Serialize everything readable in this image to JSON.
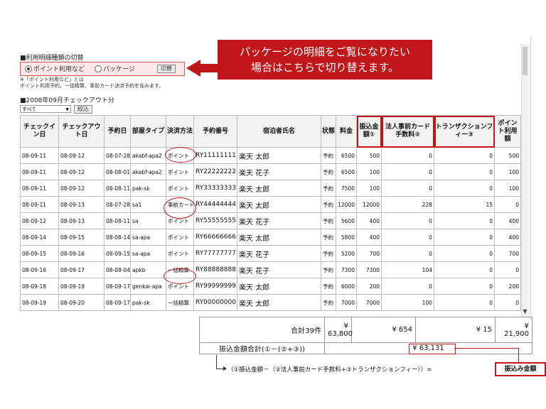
{
  "switch_section": {
    "title": "■利用明細種類の切替",
    "option_point": "ポイント利用など",
    "option_package": "パッケージ",
    "switch_button": "切替",
    "note1": "※「ポイント利用など」とは",
    "note2": "ポイント利用予約、一括精算、事前カード決済予約を含みます。"
  },
  "callout": {
    "line1": "パッケージの明細をご覧になりたい",
    "line2": "場合はこちらで切り替えます。"
  },
  "month_section": {
    "title": "■2008年09月チェックアウト分",
    "filter_value": "すべて",
    "filter_button": "絞込"
  },
  "table": {
    "headers": [
      "チェックイン日",
      "チェックアウト日",
      "予約日",
      "部屋タイプ",
      "決済方法",
      "予約番号",
      "宿泊者氏名",
      "状態",
      "料金",
      "振込金額①",
      "法人事前カード手数料②",
      "トランザクションフィー③",
      "ポイント利用額"
    ],
    "rows": [
      [
        "08-09-11",
        "08-09-12",
        "08-07-28",
        "akabf-apa2",
        "ポイント",
        "RY11111111",
        "楽天 太郎",
        "予約",
        "6500",
        "500",
        "0",
        "0",
        "500"
      ],
      [
        "08-09-11",
        "08-09-12",
        "08-08-01",
        "akabf-apa2",
        "ポイント",
        "RY22222222",
        "楽天 花子",
        "予約",
        "6500",
        "100",
        "0",
        "0",
        "100"
      ],
      [
        "08-09-11",
        "08-09-12",
        "08-08-11",
        "pak-sk",
        "ポイント",
        "RY33333333",
        "楽天 太郎",
        "予約",
        "7500",
        "100",
        "0",
        "0",
        "100"
      ],
      [
        "08-09-11",
        "08-09-13",
        "08-07-28",
        "sa1",
        "事前カード",
        "RY44444444",
        "楽天 太郎",
        "予約",
        "12000",
        "12000",
        "228",
        "15",
        "0"
      ],
      [
        "08-09-12",
        "08-09-13",
        "08-08-11",
        "sa",
        "ポイント",
        "RY55555555",
        "楽天 花子",
        "予約",
        "5600",
        "400",
        "0",
        "0",
        "400"
      ],
      [
        "08-09-14",
        "08-09-15",
        "08-08-14",
        "sa-apa",
        "ポイント",
        "RY66666666",
        "楽天 太郎",
        "予約",
        "5800",
        "400",
        "0",
        "0",
        "400"
      ],
      [
        "08-09-15",
        "08-09-16",
        "08-09-15",
        "sa-apa",
        "ポイント",
        "RY77777777",
        "楽天 花子",
        "予約",
        "5200",
        "700",
        "0",
        "0",
        "700"
      ],
      [
        "08-09-16",
        "08-09-17",
        "08-08-04",
        "apkb",
        "一括精算",
        "RY88888888",
        "楽天 花子",
        "予約",
        "7300",
        "7300",
        "104",
        "0",
        "0"
      ],
      [
        "08-09-18",
        "08-09-19",
        "08-09-17",
        "genkai-apa",
        "ポイント",
        "RY99999999",
        "楽天 太郎",
        "予約",
        "6000",
        "200",
        "0",
        "0",
        "200"
      ],
      [
        "08-09-19",
        "08-09-20",
        "08-09-17",
        "pak-sk",
        "一括精算",
        "RY00000000",
        "楽天 太郎",
        "予約",
        "7000",
        "7000",
        "100",
        "0",
        "0"
      ]
    ]
  },
  "summary": {
    "total_label": "合計39件",
    "total_transfer": "¥ 63,800",
    "total_card_fee": "¥ 654",
    "total_tx_fee": "¥ 15",
    "total_points": "¥ 21,900",
    "net_label": "振込金額合計(①－(②+③))",
    "net_value": "¥ 63,131"
  },
  "footnote": {
    "formula": "（①振込金額－（②法人事前カード手数料+③トランザクションフィー））=",
    "result": "振込み金額"
  },
  "colors": {
    "accent": "#c0161a",
    "highlight_bg": "#fde8ea"
  }
}
